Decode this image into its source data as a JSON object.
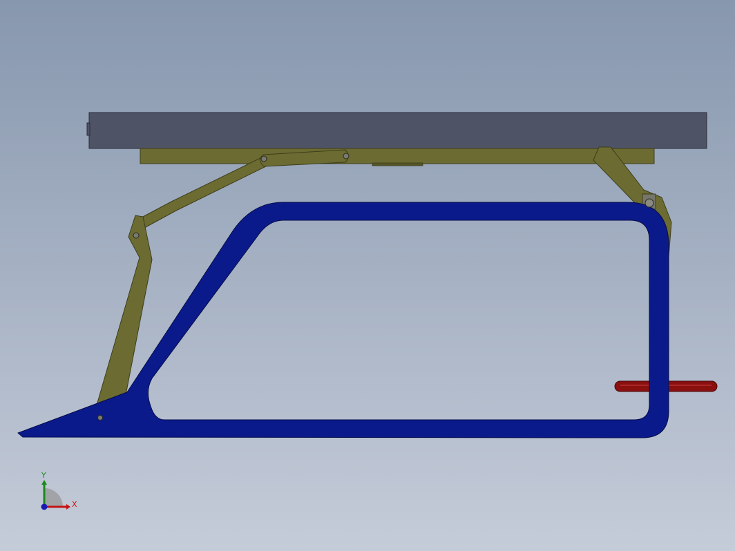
{
  "viewport": {
    "background_top": "#8797ae",
    "background_bottom": "#c5ccd9"
  },
  "colors": {
    "slab": "#4f5366",
    "linkage": "#6b6b32",
    "linkage_edge": "#3e3e1a",
    "frame": "#0b1a8a",
    "frame_edge": "#050c4a",
    "handle": "#8a1010",
    "pin": "#7a7a72"
  },
  "triad": {
    "x_label": "X",
    "y_label": "Y",
    "x_color": "#c41414",
    "y_color": "#1a8a1a",
    "z_color": "#1a1ab0"
  }
}
